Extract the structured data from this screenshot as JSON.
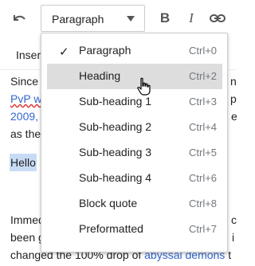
{
  "toolbar": {
    "undo_icon": "undo-icon",
    "format_selected": "Paragraph",
    "bold_label": "B",
    "italic_label": "I",
    "link_icon": "link-icon",
    "insert_label": "Insert"
  },
  "article": {
    "line1_start": "Since",
    "line1_end": "n",
    "line2_link": "PvP w",
    "line2_end": "p",
    "line3_link": "2009,",
    "line3_end": "e",
    "line4": "as the",
    "hello": "Hello",
    "line6_start": "Immed",
    "line6_end": "c",
    "line7_start": "been g",
    "line7_end": "i",
    "line8_text": "changed the 100% drop of ",
    "line8_link": "abyssal demons",
    "line8_end": " t"
  },
  "format_menu": {
    "items": [
      {
        "label": "Paragraph",
        "shortcut": "Ctrl+0",
        "checked": true
      },
      {
        "label": "Heading",
        "shortcut": "Ctrl+2",
        "hovered": true
      },
      {
        "label": "Sub-heading 1",
        "shortcut": "Ctrl+3"
      },
      {
        "label": "Sub-heading 2",
        "shortcut": "Ctrl+4"
      },
      {
        "label": "Sub-heading 3",
        "shortcut": "Ctrl+5"
      },
      {
        "label": "Sub-heading 4",
        "shortcut": "Ctrl+6"
      },
      {
        "label": "Block quote",
        "shortcut": "Ctrl+8"
      },
      {
        "label": "Preformatted",
        "shortcut": "Ctrl+7"
      }
    ],
    "check_glyph": "✓"
  }
}
